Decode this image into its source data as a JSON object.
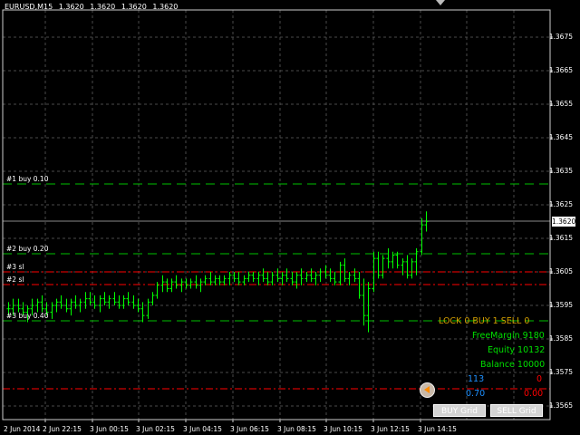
{
  "header": {
    "symbol": "EURUSD,M15",
    "quotes": [
      "1.3620",
      "1.3620",
      "1.3620",
      "1.3620"
    ]
  },
  "chart_data": {
    "type": "bar",
    "y_ticks": [
      1.3565,
      1.3575,
      1.3585,
      1.3595,
      1.3605,
      1.3615,
      1.3625,
      1.3635,
      1.3645,
      1.3655,
      1.3665,
      1.3675
    ],
    "ylim": [
      1.3561,
      1.3683
    ],
    "time_labels": [
      "2 Jun 2014",
      "2 Jun 22:15",
      "3 Jun 00:15",
      "3 Jun 02:15",
      "3 Jun 04:15",
      "3 Jun 06:15",
      "3 Jun 08:15",
      "3 Jun 10:15",
      "3 Jun 12:15",
      "3 Jun 14:15"
    ],
    "current_price": "1.3620",
    "current_price_value": 1.362,
    "grid": true,
    "bar_color": "#00ff00",
    "levels": [
      {
        "label": "#1 buy 0.10",
        "price": 1.36312,
        "color": "#00c000",
        "style": "dash"
      },
      {
        "label": "#2 buy 0.20",
        "price": 1.36103,
        "color": "#00c000",
        "style": "dash"
      },
      {
        "label": "#3 sl",
        "price": 1.3605,
        "color": "#ff0000",
        "style": "dashdot"
      },
      {
        "label": "#2 sl",
        "price": 1.36012,
        "color": "#ff0000",
        "style": "dashdot"
      },
      {
        "label": "#3 buy 0.40",
        "price": 1.35904,
        "color": "#00c000",
        "style": "dash"
      },
      {
        "label": "",
        "price": 1.35702,
        "color": "#ff0000",
        "style": "dashdot"
      }
    ],
    "bars": [
      [
        1.3594,
        1.3596,
        1.3592,
        1.3594
      ],
      [
        1.3594,
        1.3597,
        1.3592,
        1.3595
      ],
      [
        1.3595,
        1.3597,
        1.3593,
        1.3594
      ],
      [
        1.3594,
        1.3596,
        1.3592,
        1.3593
      ],
      [
        1.3593,
        1.3595,
        1.359,
        1.3594
      ],
      [
        1.3594,
        1.3597,
        1.3592,
        1.3595
      ],
      [
        1.3595,
        1.3597,
        1.3593,
        1.3596
      ],
      [
        1.3596,
        1.3598,
        1.3593,
        1.3594
      ],
      [
        1.3594,
        1.3596,
        1.3592,
        1.3593
      ],
      [
        1.3593,
        1.3596,
        1.3591,
        1.3595
      ],
      [
        1.3595,
        1.3597,
        1.3593,
        1.3596
      ],
      [
        1.3596,
        1.3598,
        1.3594,
        1.3595
      ],
      [
        1.3595,
        1.3597,
        1.3593,
        1.3594
      ],
      [
        1.3594,
        1.3597,
        1.3592,
        1.3596
      ],
      [
        1.3596,
        1.3598,
        1.3594,
        1.3595
      ],
      [
        1.3595,
        1.3597,
        1.3593,
        1.3596
      ],
      [
        1.3596,
        1.3599,
        1.3594,
        1.3597
      ],
      [
        1.3597,
        1.3599,
        1.3595,
        1.3596
      ],
      [
        1.3596,
        1.3598,
        1.3594,
        1.3595
      ],
      [
        1.3595,
        1.3598,
        1.3593,
        1.3597
      ],
      [
        1.3597,
        1.3599,
        1.3595,
        1.3596
      ],
      [
        1.3596,
        1.3598,
        1.3594,
        1.3597
      ],
      [
        1.3597,
        1.3599,
        1.3595,
        1.3596
      ],
      [
        1.3596,
        1.3598,
        1.3594,
        1.3595
      ],
      [
        1.3595,
        1.3598,
        1.3594,
        1.3597
      ],
      [
        1.3597,
        1.3599,
        1.3595,
        1.3596
      ],
      [
        1.3596,
        1.3598,
        1.3594,
        1.3595
      ],
      [
        1.3595,
        1.3597,
        1.3593,
        1.3594
      ],
      [
        1.3594,
        1.3596,
        1.359,
        1.3592
      ],
      [
        1.3592,
        1.3597,
        1.3591,
        1.3596
      ],
      [
        1.3596,
        1.3599,
        1.3595,
        1.3598
      ],
      [
        1.3598,
        1.3602,
        1.3597,
        1.3601
      ],
      [
        1.3601,
        1.3604,
        1.3599,
        1.3602
      ],
      [
        1.3602,
        1.3603,
        1.3599,
        1.36
      ],
      [
        1.36,
        1.3603,
        1.3599,
        1.3602
      ],
      [
        1.3602,
        1.3604,
        1.36,
        1.3601
      ],
      [
        1.3601,
        1.3603,
        1.3599,
        1.3602
      ],
      [
        1.3602,
        1.3603,
        1.36,
        1.3601
      ],
      [
        1.3601,
        1.3603,
        1.36,
        1.3602
      ],
      [
        1.3602,
        1.3604,
        1.36,
        1.3601
      ],
      [
        1.3601,
        1.3603,
        1.3599,
        1.3602
      ],
      [
        1.3602,
        1.3604,
        1.3601,
        1.3603
      ],
      [
        1.3603,
        1.3605,
        1.3601,
        1.3602
      ],
      [
        1.3602,
        1.3604,
        1.3601,
        1.3603
      ],
      [
        1.3603,
        1.3604,
        1.3601,
        1.3602
      ],
      [
        1.3602,
        1.3604,
        1.3601,
        1.3603
      ],
      [
        1.3603,
        1.3605,
        1.3601,
        1.3604
      ],
      [
        1.3604,
        1.3605,
        1.3602,
        1.3603
      ],
      [
        1.3603,
        1.3605,
        1.3601,
        1.3602
      ],
      [
        1.3602,
        1.3604,
        1.3601,
        1.3603
      ],
      [
        1.3603,
        1.3605,
        1.3602,
        1.3604
      ],
      [
        1.3604,
        1.3605,
        1.3602,
        1.3603
      ],
      [
        1.3603,
        1.3605,
        1.3601,
        1.3604
      ],
      [
        1.3604,
        1.3606,
        1.3602,
        1.3603
      ],
      [
        1.3603,
        1.3605,
        1.3601,
        1.3602
      ],
      [
        1.3602,
        1.3605,
        1.3601,
        1.3604
      ],
      [
        1.3604,
        1.3606,
        1.3602,
        1.3603
      ],
      [
        1.3603,
        1.3605,
        1.3601,
        1.3604
      ],
      [
        1.3604,
        1.3606,
        1.3602,
        1.3603
      ],
      [
        1.3603,
        1.3605,
        1.3601,
        1.3602
      ],
      [
        1.3602,
        1.3605,
        1.36,
        1.3604
      ],
      [
        1.3604,
        1.3606,
        1.3601,
        1.3603
      ],
      [
        1.3603,
        1.3605,
        1.3602,
        1.3604
      ],
      [
        1.3604,
        1.3606,
        1.3602,
        1.3603
      ],
      [
        1.3603,
        1.3605,
        1.3601,
        1.3604
      ],
      [
        1.3604,
        1.3606,
        1.3602,
        1.3605
      ],
      [
        1.3605,
        1.3607,
        1.3603,
        1.3604
      ],
      [
        1.3604,
        1.3606,
        1.3602,
        1.3603
      ],
      [
        1.3603,
        1.3605,
        1.3601,
        1.3602
      ],
      [
        1.3602,
        1.3608,
        1.3601,
        1.3607
      ],
      [
        1.3607,
        1.3609,
        1.3602,
        1.3603
      ],
      [
        1.3603,
        1.3605,
        1.3601,
        1.3604
      ],
      [
        1.3604,
        1.3606,
        1.3602,
        1.3603
      ],
      [
        1.3603,
        1.3605,
        1.3597,
        1.3598
      ],
      [
        1.3598,
        1.3603,
        1.3589,
        1.3592
      ],
      [
        1.3592,
        1.3602,
        1.3587,
        1.36
      ],
      [
        1.36,
        1.3611,
        1.3599,
        1.3609
      ],
      [
        1.3609,
        1.3611,
        1.3603,
        1.3604
      ],
      [
        1.3604,
        1.361,
        1.3603,
        1.3609
      ],
      [
        1.3609,
        1.3612,
        1.3606,
        1.3608
      ],
      [
        1.3608,
        1.3611,
        1.3606,
        1.361
      ],
      [
        1.361,
        1.3611,
        1.3606,
        1.3607
      ],
      [
        1.3607,
        1.3609,
        1.3604,
        1.3608
      ],
      [
        1.3608,
        1.361,
        1.3603,
        1.3604
      ],
      [
        1.3604,
        1.3609,
        1.3603,
        1.3608
      ],
      [
        1.3608,
        1.3612,
        1.3604,
        1.3611
      ],
      [
        1.3611,
        1.3621,
        1.361,
        1.3619
      ],
      [
        1.3619,
        1.3623,
        1.3617,
        1.362
      ]
    ]
  },
  "panel": {
    "lock_line": "LOCK 0  BUY 1  SELL 0",
    "free_margin": "FreeMargin 9180",
    "equity": "Equity 10132",
    "balance": "Balance 10000",
    "buy_count": "113",
    "sell_count": "0",
    "buy_lots": "0.70",
    "sell_lots": "0.00",
    "buy_grid_label": "BUY Grid",
    "sell_grid_label": "SELL Grid",
    "colors": {
      "lock": "#d4a000",
      "account": "#00e000",
      "buy": "#1e90ff",
      "sell": "#ff0000"
    }
  }
}
